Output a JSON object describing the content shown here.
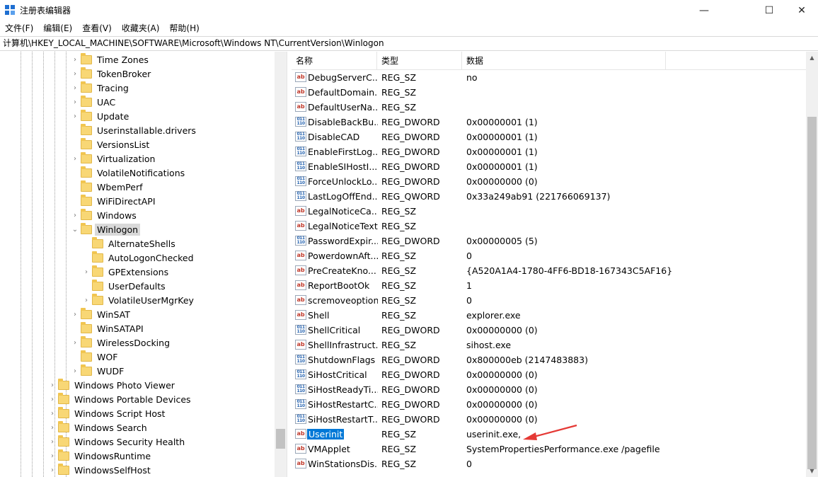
{
  "window": {
    "title": "注册表编辑器",
    "minimize": "—",
    "maximize": "☐",
    "close": "✕"
  },
  "menu": [
    "文件(F)",
    "编辑(E)",
    "查看(V)",
    "收藏夹(A)",
    "帮助(H)"
  ],
  "address": "计算机\\HKEY_LOCAL_MACHINE\\SOFTWARE\\Microsoft\\Windows NT\\CurrentVersion\\Winlogon",
  "tree": [
    {
      "label": "Time Zones",
      "level": 2,
      "expandable": true
    },
    {
      "label": "TokenBroker",
      "level": 2,
      "expandable": true
    },
    {
      "label": "Tracing",
      "level": 2,
      "expandable": true
    },
    {
      "label": "UAC",
      "level": 2,
      "expandable": true
    },
    {
      "label": "Update",
      "level": 2,
      "expandable": true
    },
    {
      "label": "Userinstallable.drivers",
      "level": 2,
      "expandable": false
    },
    {
      "label": "VersionsList",
      "level": 2,
      "expandable": false
    },
    {
      "label": "Virtualization",
      "level": 2,
      "expandable": true
    },
    {
      "label": "VolatileNotifications",
      "level": 2,
      "expandable": false
    },
    {
      "label": "WbemPerf",
      "level": 2,
      "expandable": false
    },
    {
      "label": "WiFiDirectAPI",
      "level": 2,
      "expandable": false
    },
    {
      "label": "Windows",
      "level": 2,
      "expandable": true
    },
    {
      "label": "Winlogon",
      "level": 2,
      "expandable": true,
      "expanded": true,
      "selected": true
    },
    {
      "label": "AlternateShells",
      "level": 3,
      "expandable": false
    },
    {
      "label": "AutoLogonChecked",
      "level": 3,
      "expandable": false
    },
    {
      "label": "GPExtensions",
      "level": 3,
      "expandable": true
    },
    {
      "label": "UserDefaults",
      "level": 3,
      "expandable": false
    },
    {
      "label": "VolatileUserMgrKey",
      "level": 3,
      "expandable": true
    },
    {
      "label": "WinSAT",
      "level": 2,
      "expandable": true
    },
    {
      "label": "WinSATAPI",
      "level": 2,
      "expandable": false
    },
    {
      "label": "WirelessDocking",
      "level": 2,
      "expandable": true
    },
    {
      "label": "WOF",
      "level": 2,
      "expandable": false
    },
    {
      "label": "WUDF",
      "level": 2,
      "expandable": true
    },
    {
      "label": "Windows Photo Viewer",
      "level": 1,
      "expandable": true
    },
    {
      "label": "Windows Portable Devices",
      "level": 1,
      "expandable": true
    },
    {
      "label": "Windows Script Host",
      "level": 1,
      "expandable": true
    },
    {
      "label": "Windows Search",
      "level": 1,
      "expandable": true
    },
    {
      "label": "Windows Security Health",
      "level": 1,
      "expandable": true
    },
    {
      "label": "WindowsRuntime",
      "level": 1,
      "expandable": true
    },
    {
      "label": "WindowsSelfHost",
      "level": 1,
      "expandable": true
    }
  ],
  "columns": {
    "name": "名称",
    "type": "类型",
    "data": "数据"
  },
  "values": [
    {
      "name": "DebugServerC...",
      "type": "REG_SZ",
      "data": "no",
      "icon": "sz"
    },
    {
      "name": "DefaultDomain...",
      "type": "REG_SZ",
      "data": "",
      "icon": "sz"
    },
    {
      "name": "DefaultUserNa...",
      "type": "REG_SZ",
      "data": "",
      "icon": "sz"
    },
    {
      "name": "DisableBackBu...",
      "type": "REG_DWORD",
      "data": "0x00000001 (1)",
      "icon": "bin"
    },
    {
      "name": "DisableCAD",
      "type": "REG_DWORD",
      "data": "0x00000001 (1)",
      "icon": "bin"
    },
    {
      "name": "EnableFirstLog...",
      "type": "REG_DWORD",
      "data": "0x00000001 (1)",
      "icon": "bin"
    },
    {
      "name": "EnableSIHostI...",
      "type": "REG_DWORD",
      "data": "0x00000001 (1)",
      "icon": "bin"
    },
    {
      "name": "ForceUnlockLo...",
      "type": "REG_DWORD",
      "data": "0x00000000 (0)",
      "icon": "bin"
    },
    {
      "name": "LastLogOffEnd...",
      "type": "REG_QWORD",
      "data": "0x33a249ab91 (221766069137)",
      "icon": "bin"
    },
    {
      "name": "LegalNoticeCa...",
      "type": "REG_SZ",
      "data": "",
      "icon": "sz"
    },
    {
      "name": "LegalNoticeText",
      "type": "REG_SZ",
      "data": "",
      "icon": "sz"
    },
    {
      "name": "PasswordExpir...",
      "type": "REG_DWORD",
      "data": "0x00000005 (5)",
      "icon": "bin"
    },
    {
      "name": "PowerdownAft...",
      "type": "REG_SZ",
      "data": "0",
      "icon": "sz"
    },
    {
      "name": "PreCreateKno...",
      "type": "REG_SZ",
      "data": "{A520A1A4-1780-4FF6-BD18-167343C5AF16}",
      "icon": "sz"
    },
    {
      "name": "ReportBootOk",
      "type": "REG_SZ",
      "data": "1",
      "icon": "sz"
    },
    {
      "name": "scremoveoption",
      "type": "REG_SZ",
      "data": "0",
      "icon": "sz"
    },
    {
      "name": "Shell",
      "type": "REG_SZ",
      "data": "explorer.exe",
      "icon": "sz"
    },
    {
      "name": "ShellCritical",
      "type": "REG_DWORD",
      "data": "0x00000000 (0)",
      "icon": "bin"
    },
    {
      "name": "ShellInfrastruct...",
      "type": "REG_SZ",
      "data": "sihost.exe",
      "icon": "sz"
    },
    {
      "name": "ShutdownFlags",
      "type": "REG_DWORD",
      "data": "0x800000eb (2147483883)",
      "icon": "bin"
    },
    {
      "name": "SiHostCritical",
      "type": "REG_DWORD",
      "data": "0x00000000 (0)",
      "icon": "bin"
    },
    {
      "name": "SiHostReadyTi...",
      "type": "REG_DWORD",
      "data": "0x00000000 (0)",
      "icon": "bin"
    },
    {
      "name": "SiHostRestartC...",
      "type": "REG_DWORD",
      "data": "0x00000000 (0)",
      "icon": "bin"
    },
    {
      "name": "SiHostRestartT...",
      "type": "REG_DWORD",
      "data": "0x00000000 (0)",
      "icon": "bin"
    },
    {
      "name": "Userinit",
      "type": "REG_SZ",
      "data": "userinit.exe,",
      "icon": "sz",
      "selected": true
    },
    {
      "name": "VMApplet",
      "type": "REG_SZ",
      "data": "SystemPropertiesPerformance.exe /pagefile",
      "icon": "sz"
    },
    {
      "name": "WinStationsDis...",
      "type": "REG_SZ",
      "data": "0",
      "icon": "sz"
    }
  ],
  "icons": {
    "sz": "ab",
    "bin": "011 110"
  },
  "colors": {
    "selection": "#0078d7",
    "annotation_arrow": "#e53935"
  }
}
